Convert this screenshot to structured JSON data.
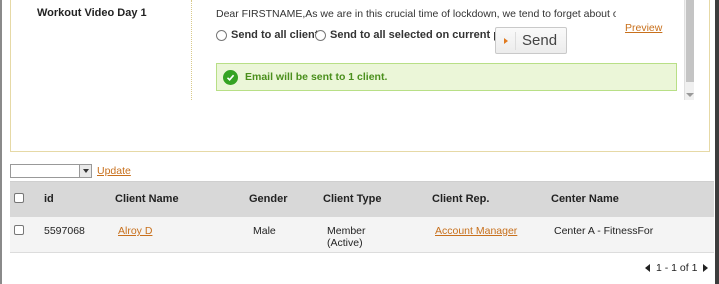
{
  "email": {
    "subject": "Workout Video Day 1",
    "body_preview": "Dear FIRSTNAME,As we are in this crucial time of lockdown, we tend to forget about our health and bi",
    "preview_link": "Preview",
    "radio_all": "Send to all clients",
    "radio_page": "Send to all selected on current page",
    "send_button": "Send",
    "success_message": "Email will be sent to 1 client."
  },
  "bulk": {
    "select_value": "",
    "update_link": "Update"
  },
  "table": {
    "headers": [
      "id",
      "Client Name",
      "Gender",
      "Client Type",
      "Client Rep.",
      "Center Name"
    ],
    "rows": [
      {
        "id": "5597068",
        "client_name": "Alroy D",
        "gender": "Male",
        "client_type_line1": "Member",
        "client_type_line2": "(Active)",
        "client_rep": "Account Manager",
        "center_name": "Center A - FitnessFor"
      }
    ]
  },
  "pager": {
    "text": "1 - 1 of 1"
  },
  "colors": {
    "link": "#c8701c",
    "success_bg": "#ebf6d8",
    "success_text": "#4a8f1c",
    "header_bg": "#d8d8d8"
  }
}
